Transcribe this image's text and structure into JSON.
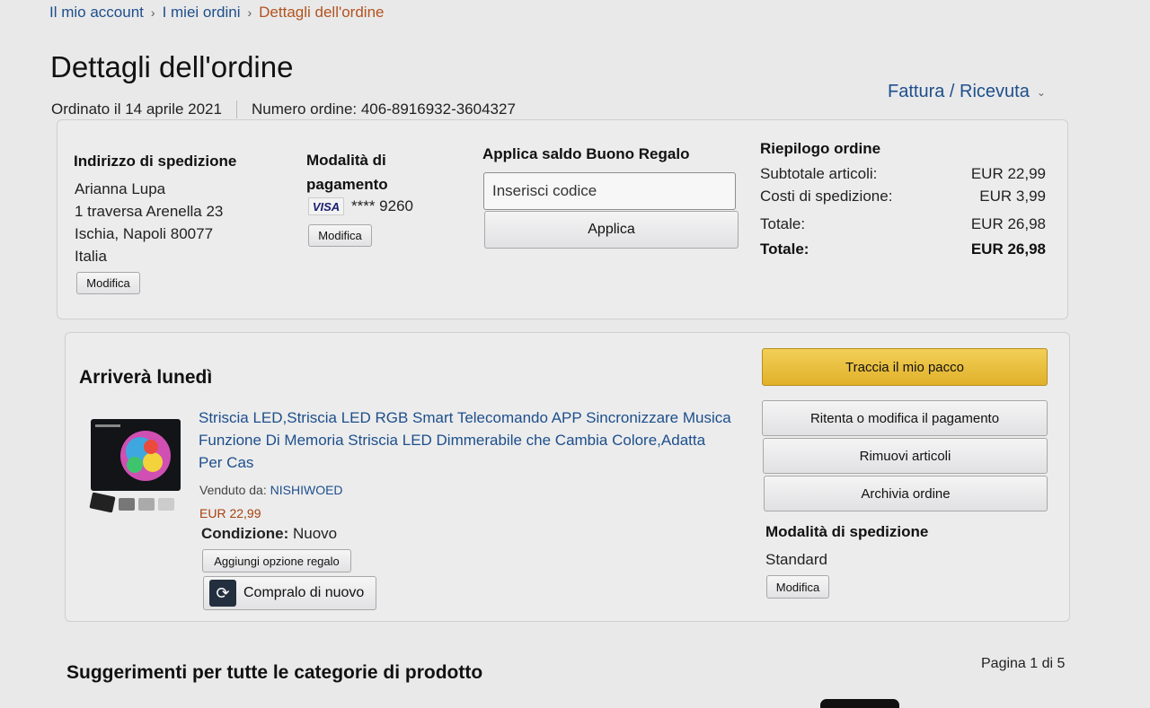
{
  "breadcrumb": [
    "Il mio account",
    "I miei ordini",
    "Dettagli dell'ordine"
  ],
  "page_title": "Dettagli dell'ordine",
  "order_meta": {
    "ordered": "Ordinato il 14 aprile 2021",
    "order_number": "Numero ordine: 406-8916932-3604327"
  },
  "invoice_link": "Fattura / Ricevuta",
  "shipping_address": {
    "heading": "Indirizzo di spedizione",
    "lines": [
      "Arianna Lupa",
      "1 traversa Arenella 23",
      "Ischia, Napoli 80077",
      "Italia"
    ],
    "modify_label": "Modifica"
  },
  "payment": {
    "heading_line1": "Modalità di",
    "heading_line2": "pagamento",
    "card_brand": "VISA",
    "card_number": "**** 9260",
    "modify_label": "Modifica"
  },
  "gift_card": {
    "heading": "Applica saldo Buono Regalo",
    "placeholder": "Inserisci codice",
    "apply_label": "Applica"
  },
  "summary": {
    "heading": "Riepilogo ordine",
    "rows": [
      {
        "label": "Subtotale articoli:",
        "value": "EUR 22,99"
      },
      {
        "label": "Costi di spedizione:",
        "value": "EUR 3,99"
      },
      {
        "label": "Totale:",
        "value": "EUR 26,98"
      },
      {
        "label": "Totale:",
        "value": "EUR 26,98"
      }
    ]
  },
  "shipment": {
    "arrival": "Arriverà lunedì",
    "product_title_lines": [
      "Striscia LED,Striscia LED RGB Smart Telecomando APP Sincronizzare Musica",
      "Funzione Di Memoria Striscia LED Dimmerabile che Cambia Colore,Adatta",
      "Per Cas"
    ],
    "sold_by_label": "Venduto da:",
    "seller": "NISHIWOED",
    "price": "EUR 22,99",
    "condition_label": "Condizione:",
    "condition_value": "Nuovo",
    "gift_option_label": "Aggiungi opzione regalo",
    "buy_again_label": "Compralo di nuovo",
    "actions": {
      "track": "Traccia il mio pacco",
      "retry_payment": "Ritenta o modifica il pagamento",
      "remove_items": "Rimuovi articoli",
      "archive": "Archivia ordine"
    },
    "shipping_method_heading": "Modalità di spedizione",
    "shipping_method_value": "Standard",
    "shipping_method_modify": "Modifica"
  },
  "suggestions_heading": "Suggerimenti per tutte le categorie di prodotto",
  "pager": "Pagina 1 di 5",
  "colors": {
    "link": "#1d4f8b",
    "breadcrumb_current": "#b3531c",
    "price": "#a8410d",
    "track_button": "#e8bd3a"
  }
}
